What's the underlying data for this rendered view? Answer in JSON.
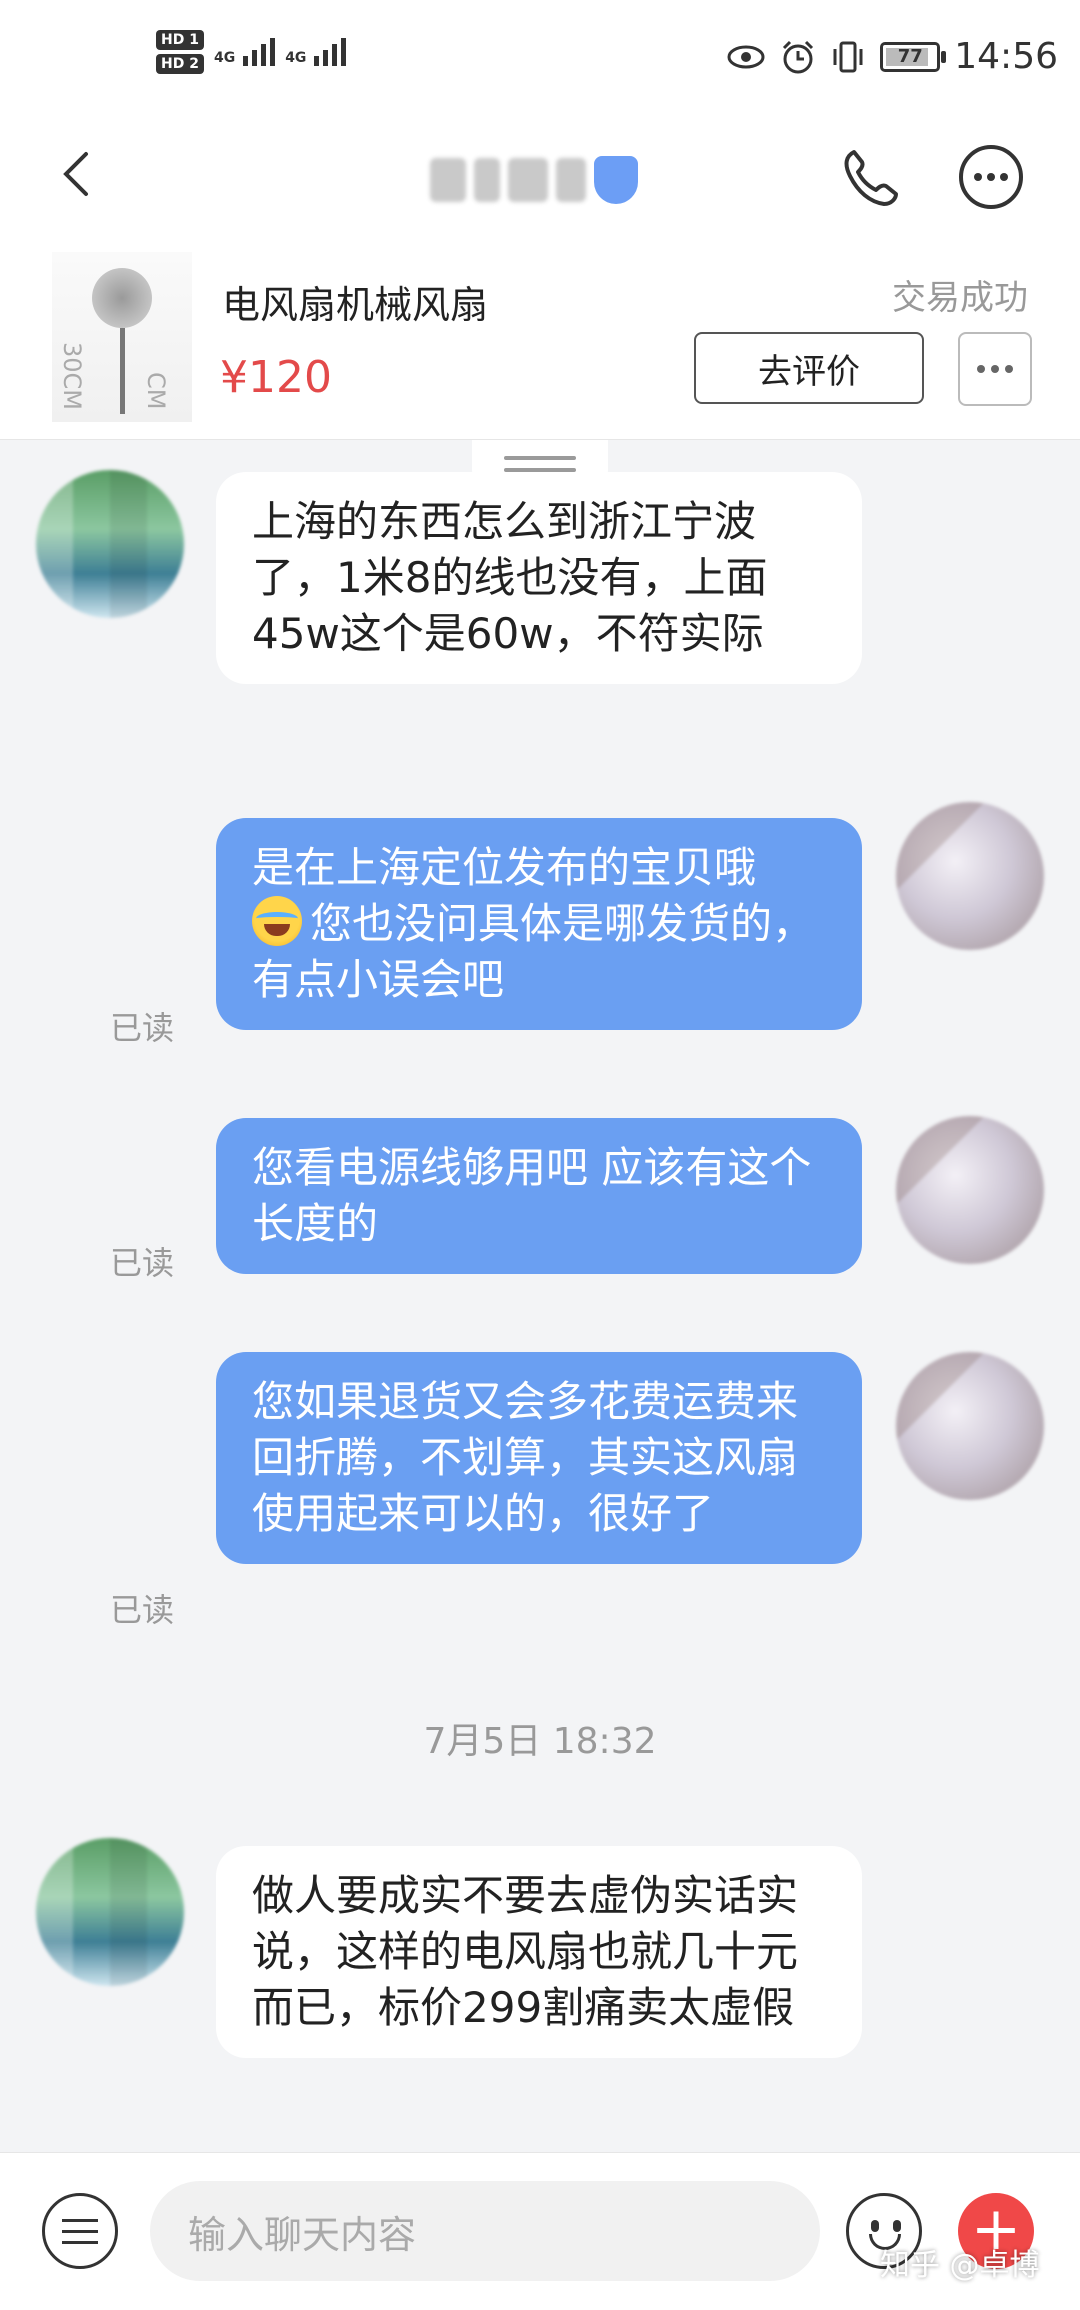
{
  "status_bar": {
    "hd1": "HD 1",
    "hd2": "HD 2",
    "sig1": "4G",
    "sig2": "4G",
    "battery": "77",
    "time": "14:56"
  },
  "header": {
    "contact_name": ""
  },
  "product": {
    "title": "电风扇机械风扇",
    "price": "¥120",
    "status": "交易成功",
    "review_button": "去评价",
    "thumb_label_left": "30CM",
    "thumb_label_right": "CM"
  },
  "messages": [
    {
      "side": "in",
      "text": "上海的东西怎么到浙江宁波了，1米8的线也没有，上面45w这个是60w，不符实际"
    },
    {
      "side": "out",
      "text_before": "是在上海定位发布的宝贝哦",
      "text_after": "您也没问具体是哪发货的，有点小误会吧",
      "read": "已读"
    },
    {
      "side": "out",
      "text": "您看电源线够用吧 应该有这个长度的",
      "read": "已读"
    },
    {
      "side": "out",
      "text": "您如果退货又会多花费运费来回折腾，不划算，其实这风扇使用起来可以的，很好了",
      "read": "已读"
    },
    {
      "side": "in",
      "text": "做人要成实不要去虚伪实话实说，这样的电风扇也就几十元而已，标价299割痛卖太虚假"
    }
  ],
  "timestamp": "7月5日 18:32",
  "input": {
    "placeholder": "输入聊天内容"
  },
  "watermark": "知乎 @卓博",
  "colors": {
    "outgoing_bubble": "#6a9ff2",
    "price": "#e34a4a",
    "add_button": "#f04848"
  }
}
